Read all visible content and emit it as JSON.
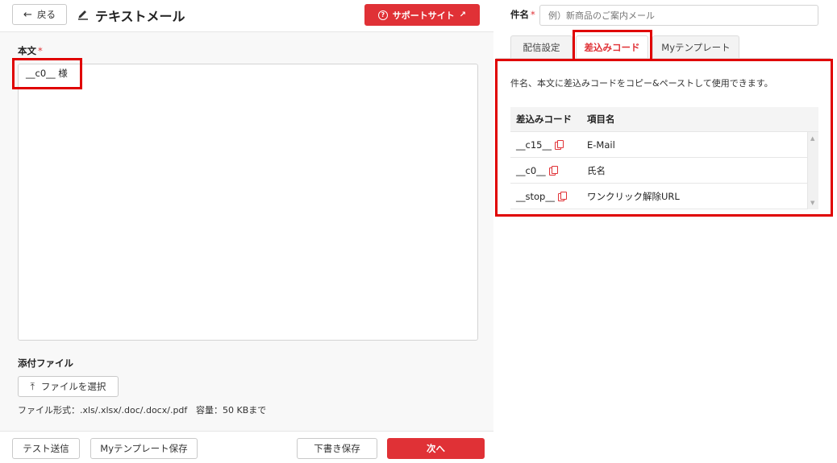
{
  "header": {
    "back_label": "戻る",
    "title": "テキストメール",
    "support_label": "サポートサイト"
  },
  "body_section": {
    "label": "本文",
    "required_mark": "*",
    "content": "__c0__ 様"
  },
  "attachment": {
    "label": "添付ファイル",
    "choose_label": "ファイルを選択",
    "formats_text": "ファイル形式：.xls/.xlsx/.doc/.docx/.pdf",
    "size_text": "容量：50 KBまで"
  },
  "footer": {
    "test_send": "テスト送信",
    "save_template": "Myテンプレート保存",
    "draft_save": "下書き保存",
    "next": "次へ"
  },
  "subject": {
    "label": "件名",
    "required_mark": "*",
    "placeholder": "例）新商品のご案内メール"
  },
  "tabs": [
    {
      "label": "配信設定"
    },
    {
      "label": "差込みコード"
    },
    {
      "label": "Myテンプレート"
    }
  ],
  "merge_panel": {
    "description": "件名、本文に差込みコードをコピー&ペーストして使用できます。",
    "columns": [
      "差込みコード",
      "項目名"
    ],
    "rows": [
      {
        "code": "__c15__",
        "name": "E-Mail"
      },
      {
        "code": "__c0__",
        "name": "氏名"
      },
      {
        "code": "__stop__",
        "name": "ワンクリック解除URL"
      }
    ]
  },
  "colors": {
    "accent": "#e03136",
    "highlight": "#e00000"
  }
}
